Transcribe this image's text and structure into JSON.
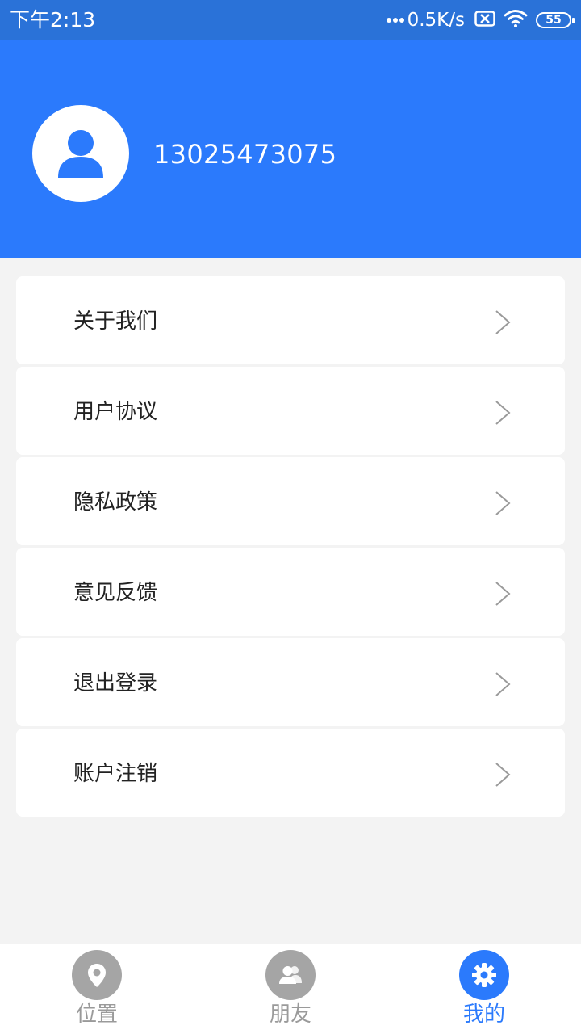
{
  "status_bar": {
    "time": "下午2:13",
    "network_speed": "0.5K/s",
    "battery": "55",
    "icons": [
      "signal-dots-icon",
      "no-sim-icon",
      "wifi-icon",
      "battery-icon"
    ]
  },
  "profile": {
    "phone": "13025473075",
    "avatar_icon": "user-icon"
  },
  "menu": {
    "items": [
      {
        "label": "关于我们",
        "icon": "chevron-right-icon"
      },
      {
        "label": "用户协议",
        "icon": "chevron-right-icon"
      },
      {
        "label": "隐私政策",
        "icon": "chevron-right-icon"
      },
      {
        "label": "意见反馈",
        "icon": "chevron-right-icon"
      },
      {
        "label": "退出登录",
        "icon": "chevron-right-icon"
      },
      {
        "label": "账户注销",
        "icon": "chevron-right-icon"
      }
    ]
  },
  "nav": {
    "tabs": [
      {
        "label": "位置",
        "icon": "location-pin-icon",
        "active": false
      },
      {
        "label": "朋友",
        "icon": "friends-icon",
        "active": false
      },
      {
        "label": "我的",
        "icon": "gear-icon",
        "active": true
      }
    ]
  },
  "colors": {
    "accent": "#2b7afc",
    "status_bar": "#2a72d8",
    "inactive": "#a5a5a5",
    "background": "#f3f3f3"
  }
}
